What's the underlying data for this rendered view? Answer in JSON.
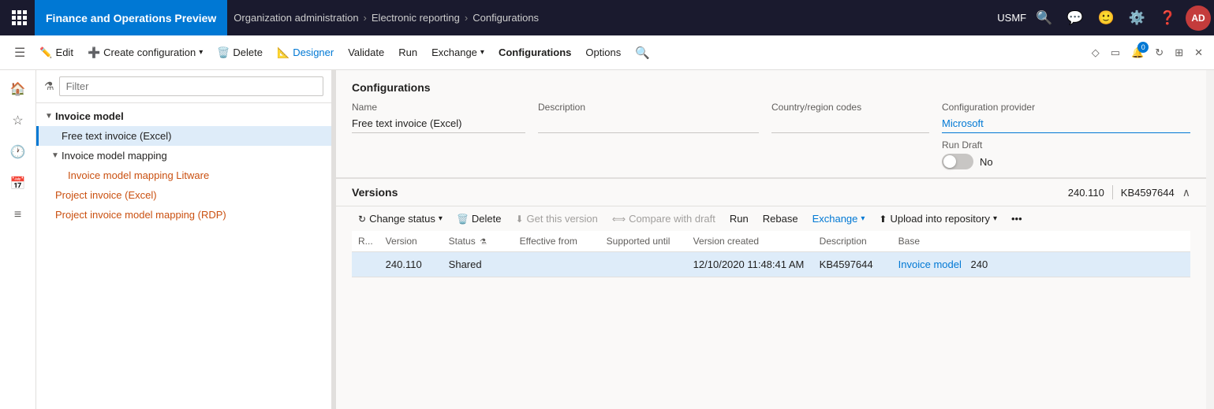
{
  "topNav": {
    "appName": "Finance and Operations Preview",
    "breadcrumb": [
      {
        "label": "Organization administration"
      },
      {
        "label": "Electronic reporting"
      },
      {
        "label": "Configurations"
      }
    ],
    "company": "USMF",
    "avatar": "AD"
  },
  "commandBar": {
    "edit": "Edit",
    "createConfig": "Create configuration",
    "delete": "Delete",
    "designer": "Designer",
    "validate": "Validate",
    "run": "Run",
    "exchange": "Exchange",
    "configurations": "Configurations",
    "options": "Options"
  },
  "sidebar": {
    "filterPlaceholder": "Filter"
  },
  "tree": {
    "items": [
      {
        "id": "invoice-model",
        "label": "Invoice model",
        "level": 0,
        "isRoot": true,
        "expanded": true
      },
      {
        "id": "free-text-excel",
        "label": "Free text invoice (Excel)",
        "level": 1,
        "selected": true
      },
      {
        "id": "invoice-model-mapping",
        "label": "Invoice model mapping",
        "level": 1,
        "expanded": true
      },
      {
        "id": "invoice-model-mapping-litware",
        "label": "Invoice model mapping Litware",
        "level": 2,
        "isOrange": true
      },
      {
        "id": "project-invoice-excel",
        "label": "Project invoice (Excel)",
        "level": 1,
        "isOrange": true
      },
      {
        "id": "project-invoice-model-mapping-rdp",
        "label": "Project invoice model mapping (RDP)",
        "level": 1,
        "isOrange": true
      }
    ]
  },
  "configurations": {
    "sectionTitle": "Configurations",
    "columns": {
      "name": "Name",
      "description": "Description",
      "countryRegion": "Country/region codes",
      "provider": "Configuration provider"
    },
    "values": {
      "name": "Free text invoice (Excel)",
      "description": "",
      "countryRegion": "",
      "provider": "Microsoft"
    },
    "runDraft": {
      "label": "Run Draft",
      "value": "No",
      "enabled": false
    }
  },
  "versions": {
    "sectionTitle": "Versions",
    "versionNumber": "240.110",
    "kbNumber": "KB4597644",
    "toolbar": {
      "changeStatus": "Change status",
      "delete": "Delete",
      "getThisVersion": "Get this version",
      "compareWithDraft": "Compare with draft",
      "run": "Run",
      "rebase": "Rebase",
      "exchange": "Exchange",
      "uploadIntoRepository": "Upload into repository"
    },
    "tableColumns": [
      "R...",
      "Version",
      "Status",
      "Effective from",
      "Supported until",
      "Version created",
      "Description",
      "Base"
    ],
    "rows": [
      {
        "r": "",
        "version": "240.110",
        "status": "Shared",
        "effectiveFrom": "",
        "supportedUntil": "",
        "versionCreated": "12/10/2020 11:48:41 AM",
        "description": "KB4597644",
        "base": "Invoice model",
        "baseNum": "240",
        "selected": true
      }
    ]
  }
}
